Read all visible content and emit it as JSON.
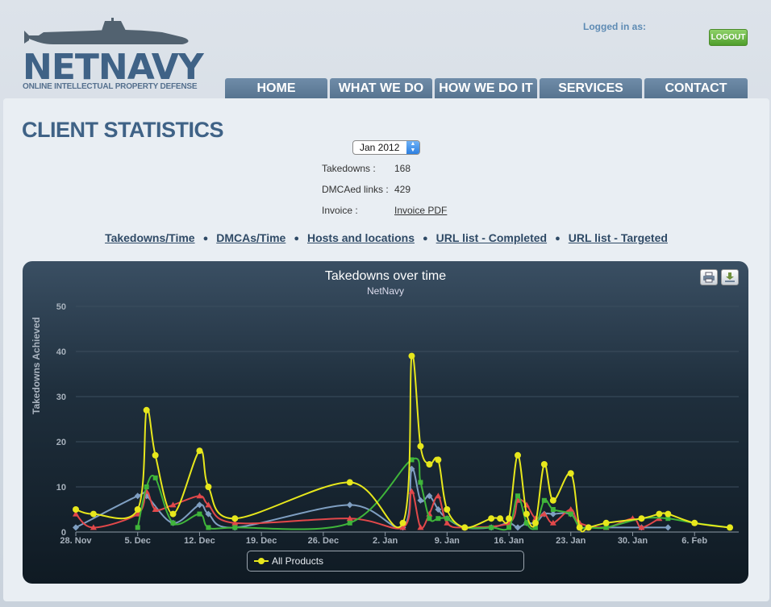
{
  "header": {
    "logo_text": "NETNAVY",
    "logo_tagline": "ONLINE INTELLECTUAL PROPERTY DEFENSE",
    "logged_in_label": "Logged in as:",
    "logout_label": "LOGOUT"
  },
  "nav": [
    "HOME",
    "WHAT WE DO",
    "HOW WE DO IT",
    "SERVICES",
    "CONTACT"
  ],
  "page_title": "CLIENT STATISTICS",
  "month_select": {
    "value": "Jan 2012"
  },
  "stats": {
    "takedowns_label": "Takedowns :",
    "takedowns_value": "168",
    "dmca_label": "DMCAed links :",
    "dmca_value": "429",
    "invoice_label": "Invoice :",
    "invoice_link": "Invoice PDF"
  },
  "tabs": [
    "Takedowns/Time",
    "DMCAs/Time",
    "Hosts and locations",
    "URL list - Completed",
    "URL list - Targeted"
  ],
  "colors": {
    "yellow": "#e7e71c",
    "green": "#3fb53a",
    "blue": "#7f9fc2",
    "red": "#e2484a",
    "brand": "#3f6286"
  },
  "icons": [
    "print-icon",
    "download-icon"
  ],
  "chart_data": {
    "type": "line",
    "title": "Takedowns over time",
    "subtitle": "NetNavy",
    "ylabel": "Takedowns Achieved",
    "ylim": [
      0,
      50
    ],
    "yticks": [
      0,
      10,
      20,
      30,
      40,
      50
    ],
    "xlim": [
      0,
      75
    ],
    "xticks": [
      {
        "x": 0,
        "label": "28. Nov"
      },
      {
        "x": 7,
        "label": "5. Dec"
      },
      {
        "x": 14,
        "label": "12. Dec"
      },
      {
        "x": 21,
        "label": "19. Dec"
      },
      {
        "x": 28,
        "label": "26. Dec"
      },
      {
        "x": 35,
        "label": "2. Jan"
      },
      {
        "x": 42,
        "label": "9. Jan"
      },
      {
        "x": 49,
        "label": "16. Jan"
      },
      {
        "x": 56,
        "label": "23. Jan"
      },
      {
        "x": 63,
        "label": "30. Jan"
      },
      {
        "x": 70,
        "label": "6. Feb"
      }
    ],
    "grid": true,
    "legend_entries": [
      "All Products"
    ],
    "series": [
      {
        "name": "All Products",
        "color": "#e7e71c",
        "marker": "circle",
        "points": [
          [
            0,
            5
          ],
          [
            2,
            4
          ],
          [
            7,
            5
          ],
          [
            8,
            27
          ],
          [
            9,
            17
          ],
          [
            11,
            4
          ],
          [
            14,
            18
          ],
          [
            15,
            10
          ],
          [
            18,
            3
          ],
          [
            31,
            11
          ],
          [
            37,
            2
          ],
          [
            38,
            39
          ],
          [
            39,
            19
          ],
          [
            40,
            15
          ],
          [
            41,
            16
          ],
          [
            42,
            5
          ],
          [
            44,
            1
          ],
          [
            47,
            3
          ],
          [
            48,
            3
          ],
          [
            49,
            3
          ],
          [
            50,
            17
          ],
          [
            51,
            4
          ],
          [
            52,
            2
          ],
          [
            53,
            15
          ],
          [
            54,
            7
          ],
          [
            56,
            13
          ],
          [
            57,
            1
          ],
          [
            58,
            1
          ],
          [
            60,
            2
          ],
          [
            64,
            3
          ],
          [
            66,
            4
          ],
          [
            67,
            4
          ],
          [
            70,
            2
          ],
          [
            74,
            1
          ]
        ]
      },
      {
        "name": "",
        "color": "#3fb53a",
        "marker": "square",
        "points": [
          [
            7,
            1
          ],
          [
            8,
            10
          ],
          [
            9,
            12
          ],
          [
            11,
            2
          ],
          [
            14,
            4
          ],
          [
            15,
            1
          ],
          [
            18,
            1
          ],
          [
            31,
            2
          ],
          [
            38,
            16
          ],
          [
            39,
            11
          ],
          [
            40,
            3
          ],
          [
            41,
            3
          ],
          [
            42,
            3
          ],
          [
            44,
            1
          ],
          [
            47,
            1
          ],
          [
            49,
            1
          ],
          [
            50,
            8
          ],
          [
            51,
            2
          ],
          [
            52,
            1
          ],
          [
            53,
            7
          ],
          [
            54,
            5
          ],
          [
            56,
            4
          ],
          [
            57,
            1
          ],
          [
            58,
            1
          ],
          [
            60,
            1
          ],
          [
            64,
            3
          ],
          [
            67,
            3
          ],
          [
            70,
            2
          ],
          [
            74,
            1
          ]
        ]
      },
      {
        "name": "",
        "color": "#7f9fc2",
        "marker": "diamond",
        "points": [
          [
            0,
            1
          ],
          [
            7,
            8
          ],
          [
            8,
            8
          ],
          [
            11,
            2
          ],
          [
            14,
            6
          ],
          [
            15,
            4
          ],
          [
            18,
            1
          ],
          [
            31,
            6
          ],
          [
            37,
            1
          ],
          [
            38,
            14
          ],
          [
            39,
            7
          ],
          [
            40,
            8
          ],
          [
            41,
            5
          ],
          [
            42,
            3
          ],
          [
            44,
            1
          ],
          [
            47,
            1
          ],
          [
            49,
            2
          ],
          [
            50,
            1
          ],
          [
            51,
            2
          ],
          [
            52,
            2
          ],
          [
            53,
            4
          ],
          [
            54,
            4
          ],
          [
            56,
            4
          ],
          [
            57,
            1
          ],
          [
            58,
            1
          ],
          [
            64,
            1
          ],
          [
            67,
            1
          ]
        ]
      },
      {
        "name": "",
        "color": "#e2484a",
        "marker": "triangle",
        "points": [
          [
            0,
            4
          ],
          [
            2,
            1
          ],
          [
            7,
            4
          ],
          [
            8,
            9
          ],
          [
            9,
            5
          ],
          [
            11,
            6
          ],
          [
            14,
            8
          ],
          [
            15,
            6
          ],
          [
            18,
            2
          ],
          [
            31,
            3
          ],
          [
            37,
            1
          ],
          [
            38,
            9
          ],
          [
            39,
            1
          ],
          [
            40,
            4
          ],
          [
            41,
            8
          ],
          [
            42,
            2
          ],
          [
            44,
            1
          ],
          [
            49,
            2
          ],
          [
            50,
            7
          ],
          [
            51,
            6
          ],
          [
            52,
            3
          ],
          [
            53,
            4
          ],
          [
            54,
            2
          ],
          [
            56,
            5
          ],
          [
            57,
            2
          ],
          [
            60,
            1
          ],
          [
            63,
            3
          ],
          [
            64,
            1
          ],
          [
            66,
            3
          ]
        ]
      }
    ]
  }
}
